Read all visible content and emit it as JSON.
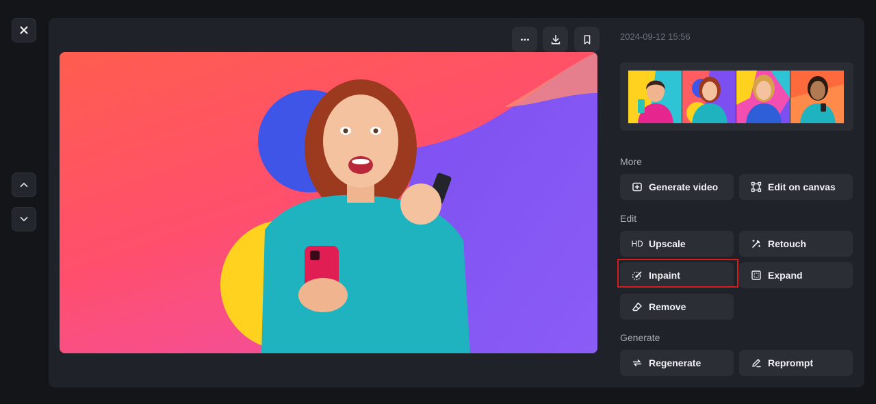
{
  "nav": {
    "close_icon": "close-icon",
    "prev_icon": "chevron-up-icon",
    "next_icon": "chevron-down-icon"
  },
  "toolbar": {
    "more_icon": "more-icon",
    "download_icon": "download-icon",
    "bookmark_icon": "bookmark-icon"
  },
  "details": {
    "timestamp": "2024-09-12 15:56"
  },
  "sections": {
    "more": {
      "label": "More",
      "actions": [
        {
          "label": "Generate video",
          "icon": "video-plus-icon"
        },
        {
          "label": "Edit on canvas",
          "icon": "canvas-icon"
        }
      ]
    },
    "edit": {
      "label": "Edit",
      "actions": [
        {
          "label": "Upscale",
          "icon": "hd-icon",
          "icon_text": "HD"
        },
        {
          "label": "Retouch",
          "icon": "magic-wand-icon"
        },
        {
          "label": "Inpaint",
          "icon": "brush-icon",
          "highlighted": true
        },
        {
          "label": "Expand",
          "icon": "expand-icon"
        },
        {
          "label": "Remove",
          "icon": "eraser-icon"
        }
      ]
    },
    "generate": {
      "label": "Generate",
      "actions": [
        {
          "label": "Regenerate",
          "icon": "refresh-icon"
        },
        {
          "label": "Reprompt",
          "icon": "pencil-icon"
        }
      ]
    }
  },
  "colors": {
    "background": "#141518",
    "panel": "#1f2228",
    "button": "#2b2e35",
    "highlight_border": "#d51d1d",
    "muted_text": "#6f747d"
  }
}
